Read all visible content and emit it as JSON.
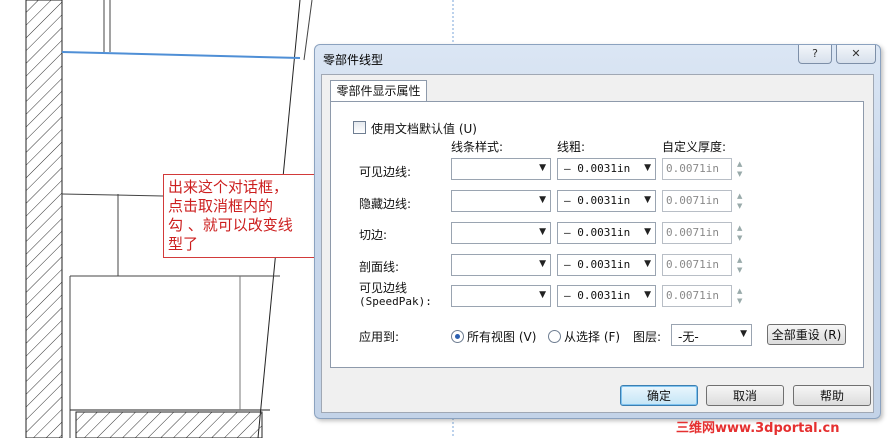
{
  "annotation": {
    "lines": [
      "出来这个对话框，",
      "点击取消框内的",
      "勾 、就可以改变线",
      "型了"
    ]
  },
  "dialog": {
    "title": "零部件线型",
    "help_button": "?",
    "close_button": "✕",
    "tab_label": "零部件显示属性",
    "use_default_label": "使用文档默认值 (U)",
    "use_default_checked": false,
    "headers": {
      "style": "线条样式:",
      "width": "线粗:",
      "custom_thickness": "自定义厚度:"
    },
    "rows": [
      {
        "label": "可见边线:",
        "style": "solid",
        "width": "— 0.0031in",
        "thickness": "0.0071in"
      },
      {
        "label": "隐藏边线:",
        "style": "dashed",
        "width": "— 0.0031in",
        "thickness": "0.0071in"
      },
      {
        "label": "切边:",
        "style": "dashdot",
        "width": "— 0.0031in",
        "thickness": "0.0071in"
      },
      {
        "label": "剖面线:",
        "style": "solid",
        "width": "— 0.0031in",
        "thickness": "0.0071in"
      },
      {
        "label": "可见边线\n(SpeedPak):",
        "label_line1": "可见边线",
        "label_line2": "(SpeedPak):",
        "style": "solid",
        "width": "— 0.0031in",
        "thickness": "0.0071in"
      }
    ],
    "apply_to_label": "应用到:",
    "radio_all_views": "所有视图 (V)",
    "radio_from_selection": "从选择 (F)",
    "radio_selected": "all_views",
    "layer_label": "图层:",
    "layer_value": "-无-",
    "reset_all_button": "全部重设 (R)",
    "ok_button": "确定",
    "cancel_button": "取消",
    "help_text_button": "帮助"
  },
  "watermark": "三维网www.3dportal.cn",
  "colors": {
    "accent_blue": "#4f8fd6",
    "annotation_red": "#cc1f1f"
  }
}
